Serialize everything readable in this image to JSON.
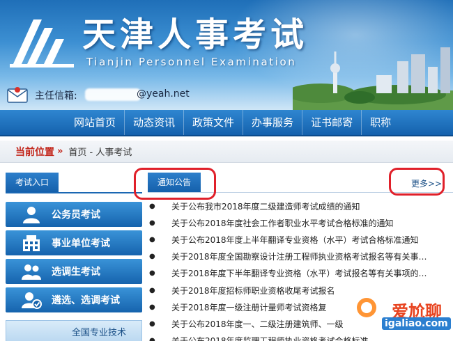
{
  "header": {
    "title": "天津人事考试",
    "subtitle": "Tianjin Personnel Examination",
    "mail_label": "主任信箱:",
    "mail_domain": "@yeah.net"
  },
  "nav": {
    "items": [
      "网站首页",
      "动态资讯",
      "政策文件",
      "办事服务",
      "证书邮寄",
      "职称"
    ]
  },
  "breadcrumb": {
    "label": "当前位置",
    "arrow": "»",
    "path": "首页 - 人事考试"
  },
  "sidebar": {
    "tab_label": "考试入口",
    "buttons": [
      {
        "label": "公务员考试",
        "icon": "person-icon"
      },
      {
        "label": "事业单位考试",
        "icon": "building-icon"
      },
      {
        "label": "选调生考试",
        "icon": "people-icon"
      },
      {
        "label": "遴选、选调考试",
        "icon": "user-check-icon"
      }
    ],
    "extra_label": "全国专业技术"
  },
  "notices": {
    "tab_label": "通知公告",
    "more_label": "更多>>",
    "items": [
      "关于公布我市2018年度二级建造师考试成绩的通知",
      "关于公布2018年度社会工作者职业水平考试合格标准的通知",
      "关于公布2018年度上半年翻译专业资格（水平）考试合格标准通知",
      "关于2018年度全国勘察设计注册工程师执业资格考试报名等有关事…",
      "关于2018年度下半年翻译专业资格（水平）考试报名等有关事项的…",
      "关于2018年度招标师职业资格收尾考试报名",
      "关于2018年度一级注册计量师考试资格复",
      "关于公布2018年度一、二级注册建筑师、一级",
      "关于公布2018年度监理工程师执业资格考试合格标准"
    ]
  },
  "watermark": {
    "text": "爱尬聊",
    "url": "igaliao.com"
  },
  "colors": {
    "brand_blue": "#1461ad",
    "highlight_red": "#e0202a",
    "crumb_red": "#c2261b"
  }
}
